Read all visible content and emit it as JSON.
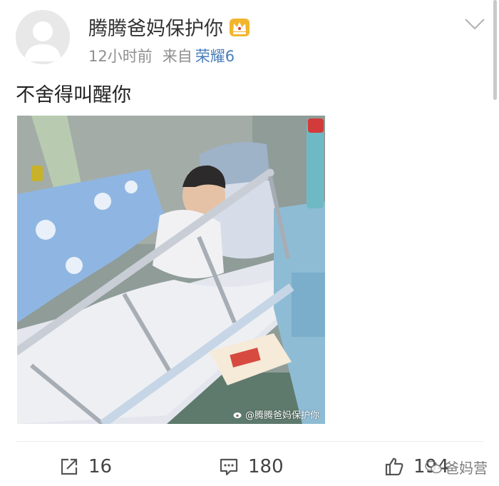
{
  "post": {
    "author": "腾腾爸妈保护你",
    "time": "12小时前",
    "source_prefix": "来自",
    "device": "荣耀6",
    "text": "不舍得叫醒你",
    "image_watermark": "@腾腾爸妈保护你",
    "menu_icon": "chevron-down-icon",
    "badge_icon": "crown-icon"
  },
  "actions": {
    "share_count": "16",
    "comment_count": "180",
    "like_count": "194"
  },
  "brand_watermark": "爸妈营",
  "colors": {
    "device_link": "#4a7db8",
    "crown": "#f2b52d",
    "meta": "#8f8f8f"
  }
}
